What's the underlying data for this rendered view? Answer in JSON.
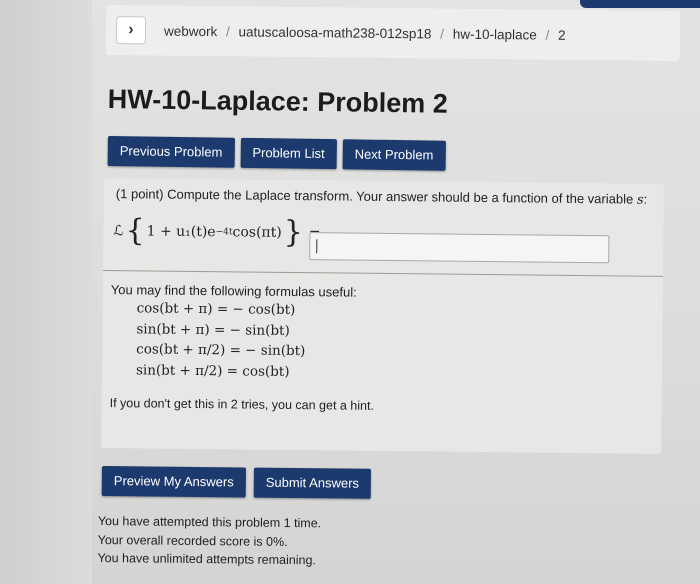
{
  "breadcrumb": {
    "back_icon": "chevron-right-icon",
    "back_glyph": "›",
    "parts": [
      "webwork",
      "uatuscaloosa-math238-012sp18",
      "hw-10-laplace",
      "2"
    ],
    "separator": "/"
  },
  "page_title": "HW-10-Laplace: Problem 2",
  "nav": {
    "previous": "Previous Problem",
    "list": "Problem List",
    "next": "Next Problem"
  },
  "problem": {
    "prompt_start": "(1 point) Compute the Laplace transform. Your answer should be a function of the variable",
    "prompt_variable": "s",
    "prompt_end": ":",
    "equation": {
      "operator": "ℒ",
      "left_brace": "{",
      "expression": "1 + u₁(t)e",
      "exponent": "−4t",
      "trig": " cos(πt)",
      "right_brace": "}",
      "equals": "="
    },
    "answer_value": "",
    "useful_intro": "You may find the following formulas useful:",
    "formulas": [
      "cos(bt + π) = − cos(bt)",
      "sin(bt + π) = − sin(bt)",
      "cos(bt + π/2) = − sin(bt)",
      "sin(bt + π/2) = cos(bt)"
    ],
    "hint_text": "If you don't get this in 2 tries, you can get a hint."
  },
  "actions": {
    "preview": "Preview My Answers",
    "submit": "Submit Answers"
  },
  "status": [
    "You have attempted this problem 1 time.",
    "Your overall recorded score is 0%.",
    "You have unlimited attempts remaining."
  ],
  "colors": {
    "button_bg": "#1d3a6e",
    "button_text": "#ffffff",
    "panel_bg": "#e7e7e5"
  }
}
